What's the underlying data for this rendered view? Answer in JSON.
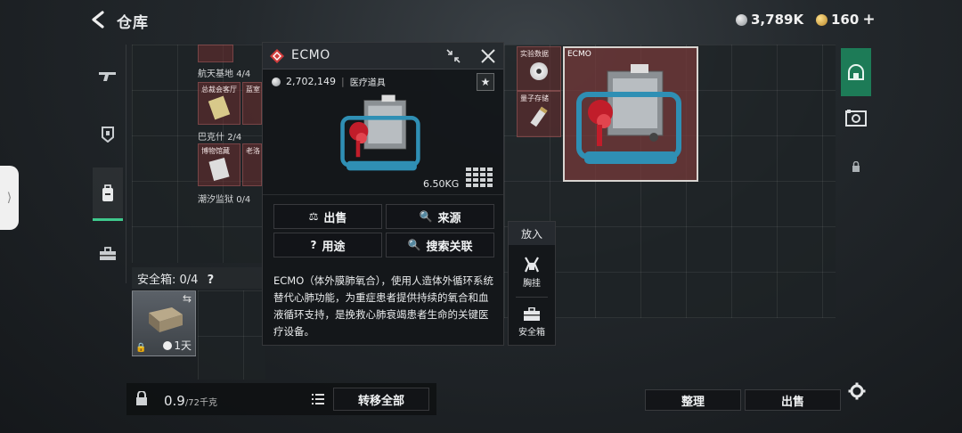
{
  "topbar": {
    "back_icon": "chevron-left-icon",
    "title": "仓库"
  },
  "currency": [
    {
      "icon": "silver-coin-icon",
      "value": "3,789K",
      "color": "#b9bec2"
    },
    {
      "icon": "gold-coin-icon",
      "value": "160",
      "color": "#d9b24a",
      "plus": "+"
    }
  ],
  "left_nav": [
    {
      "icon": "gun-icon",
      "label": "武器"
    },
    {
      "icon": "armor-icon",
      "label": "护甲"
    },
    {
      "icon": "backpack-icon",
      "label": "背包",
      "active": true
    },
    {
      "icon": "toolbox-icon",
      "label": "工具箱"
    }
  ],
  "storage_left": {
    "rows": [
      {
        "name": "航天基地",
        "count": "4/4"
      },
      {
        "name": "巴克什",
        "count": "2/4"
      },
      {
        "name": "潮汐监狱",
        "count": "0/4"
      }
    ],
    "item_tags": [
      "总裁会客厅",
      "蓝室",
      "博物馆藏",
      "老洛"
    ]
  },
  "safebox": {
    "title": "安全箱: 0/4",
    "help": "?",
    "duration": "1天",
    "swap_icon": "swap-icon"
  },
  "footer_left": {
    "weight": "0.9",
    "weight_unit": "/72千克",
    "list_icon": "list-icon",
    "transfer_all": "转移全部"
  },
  "popup": {
    "title": "ECMO",
    "price": "2,702,149",
    "category": "医疗道具",
    "weight": "6.50KG",
    "star": "★",
    "buttons": {
      "sell": "出售",
      "source": "来源",
      "usage": "用途",
      "search": "搜索关联"
    },
    "description": "ECMO（体外膜肺氧合），使用人造体外循环系统替代心肺功能，为重症患者提供持续的氧合和血液循环支持，是挽救心肺衰竭患者生命的关键医疗设备。"
  },
  "put_menu": {
    "title": "放入",
    "options": [
      {
        "icon": "chest-rig-icon",
        "label": "胸挂"
      },
      {
        "icon": "safebox-icon",
        "label": "安全箱"
      }
    ]
  },
  "storage_right": {
    "items": [
      {
        "label": "实验数据",
        "icon": "disc-icon"
      },
      {
        "label": "量子存储",
        "icon": "usb-drive-icon"
      },
      {
        "label": "ECMO",
        "icon": "ecmo-device-icon"
      }
    ]
  },
  "right_tabs": [
    {
      "icon": "vault-icon",
      "active": true
    },
    {
      "icon": "storage-rack-icon"
    },
    {
      "icon": "lock-icon"
    }
  ],
  "footer_right": {
    "organize": "整理",
    "sell": "出售",
    "settings_icon": "gear-icon"
  }
}
